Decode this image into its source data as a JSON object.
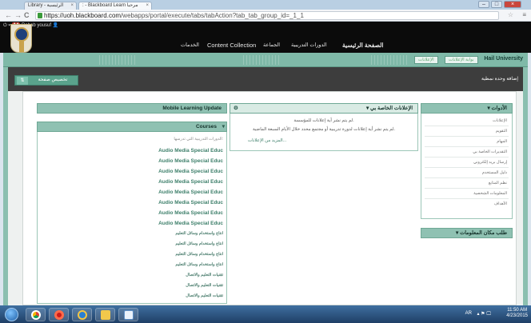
{
  "browser": {
    "tabs": [
      {
        "label": "Library - الرئيسية"
      },
      {
        "label": ": - Blackboard Learn مرحباً"
      }
    ],
    "url_host": "https://uoh.blackboard.com",
    "url_path": "/webapps/portal/execute/tabs/tabAction?tab_tab_group_id=_1_1",
    "controls": {
      "back": "←",
      "forward": "→",
      "reload": "C",
      "star": "☆",
      "menu": "≡"
    }
  },
  "user": {
    "badge": "14",
    "name": "Rabab yousuf"
  },
  "top_nav": {
    "home": "الصفحة الرئيسية",
    "courses": "الدورات التدريبية",
    "community": "الجماعة",
    "content_collection": "Content Collection",
    "services": "الخدمات"
  },
  "banner": {
    "university": "Hail University",
    "tab1": "بوابة الإعلانات",
    "tab2": "الإعلانات"
  },
  "page_tab": {
    "label": "تخصيص صفحة",
    "icon": "⇅",
    "add_module": "إضافة وحدة نمطية"
  },
  "modules": {
    "mobile_learning": {
      "title": "Mobile Learning Update"
    },
    "announcements": {
      "title": "الإعلانات الخاصة بي",
      "line1": "لم يتم نشر أية إعلانات للمؤسسة.",
      "line2": "لم يتم نشر أية إعلانات لدورة تدريبية أو مجتمع محدد خلال الأيام السبعة الماضية.",
      "more": "المزيد من الإعلانات..."
    },
    "courses": {
      "title": "Courses",
      "subtitle": "الدورات التدريبية التي تدرسها:",
      "items": [
        "Audio Media Special Educ",
        "Audio Media Special Educ",
        "Audio Media Special Educ",
        "Audio Media Special Educ",
        "Audio Media Special Educ",
        "Audio Media Special Educ",
        "Audio Media Special Educ",
        "Audio Media Special Educ",
        "انتاج واستخدام وسائل التعليم",
        "انتاج واستخدام وسائل التعليم",
        "انتاج واستخدام وسائل التعليم",
        "انتاج واستخدام وسائل التعليم",
        "تقنيات التعليم والاتصال",
        "تقنيات التعليم والاتصال",
        "تقنيات التعليم والاتصال"
      ]
    },
    "tools": {
      "title": "الأدوات",
      "items": [
        "الإعلانات",
        "التقويم",
        "المهام",
        "التقديرات الخاصة بي",
        "إرسال بريد إلكتروني",
        "دليل المستخدم",
        "نظم المتابع",
        "المعلومات الشخصية",
        "الأهداف"
      ]
    },
    "support": {
      "title": "طلب مكان المعلومات"
    }
  },
  "taskbar": {
    "clock_time": "11:50 AM",
    "clock_date": "4/23/2015",
    "lang": "AR"
  }
}
